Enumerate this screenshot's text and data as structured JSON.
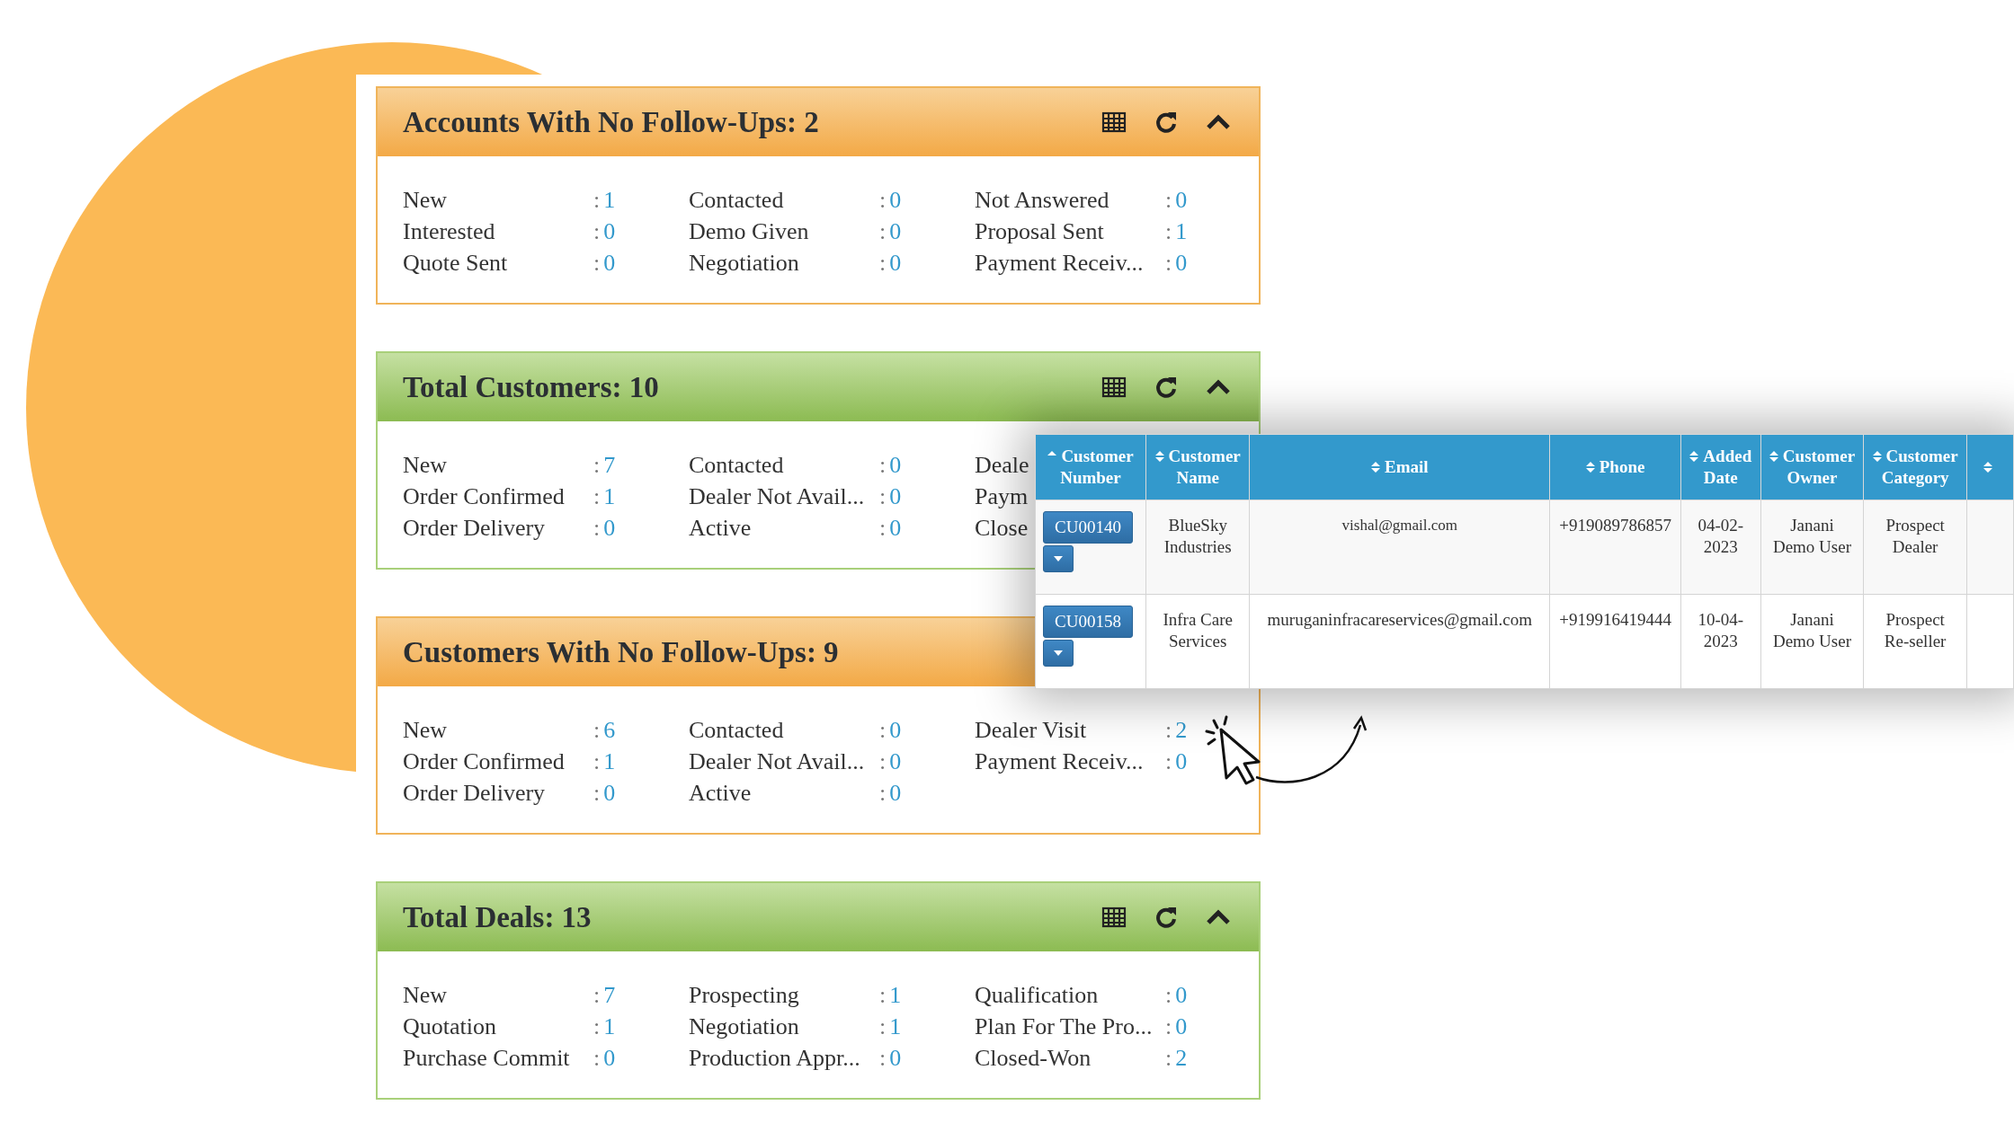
{
  "cards": [
    {
      "title": "Accounts With No Follow-Ups: 2",
      "kind": "orange",
      "columns": [
        [
          {
            "label": "New",
            "sep": ":",
            "value": "1"
          },
          {
            "label": "Interested",
            "sep": ":",
            "value": "0"
          },
          {
            "label": "Quote Sent",
            "sep": ":",
            "value": "0"
          }
        ],
        [
          {
            "label": "Contacted",
            "sep": ":",
            "value": "0"
          },
          {
            "label": "Demo Given",
            "sep": ":",
            "value": "0"
          },
          {
            "label": "Negotiation",
            "sep": ":",
            "value": "0"
          }
        ],
        [
          {
            "label": "Not Answered",
            "sep": ":",
            "value": "0"
          },
          {
            "label": "Proposal Sent",
            "sep": ":",
            "value": "1"
          },
          {
            "label": "Payment Receiv...",
            "sep": ":",
            "value": "0"
          }
        ]
      ]
    },
    {
      "title": "Total Customers: 10",
      "kind": "green",
      "columns": [
        [
          {
            "label": "New",
            "sep": ":",
            "value": "7"
          },
          {
            "label": "Order Confirmed",
            "sep": ":",
            "value": "1"
          },
          {
            "label": "Order Delivery",
            "sep": ":",
            "value": "0"
          }
        ],
        [
          {
            "label": "Contacted",
            "sep": ":",
            "value": "0"
          },
          {
            "label": "Dealer Not Avail...",
            "sep": ":",
            "value": "0"
          },
          {
            "label": "Active",
            "sep": ":",
            "value": "0"
          }
        ],
        [
          {
            "label": "Deale"
          },
          {
            "label": "Paym"
          },
          {
            "label": "Close"
          }
        ]
      ]
    },
    {
      "title": "Customers With No Follow-Ups: 9",
      "kind": "orange",
      "columns": [
        [
          {
            "label": "New",
            "sep": ":",
            "value": "6"
          },
          {
            "label": "Order Confirmed",
            "sep": ":",
            "value": "1"
          },
          {
            "label": "Order Delivery",
            "sep": ":",
            "value": "0"
          }
        ],
        [
          {
            "label": "Contacted",
            "sep": ":",
            "value": "0"
          },
          {
            "label": "Dealer Not Avail...",
            "sep": ":",
            "value": "0"
          },
          {
            "label": "Active",
            "sep": ":",
            "value": "0"
          }
        ],
        [
          {
            "label": "Dealer Visit",
            "sep": ":",
            "value": "2"
          },
          {
            "label": "Payment Receiv...",
            "sep": ":",
            "value": "0"
          }
        ]
      ]
    },
    {
      "title": "Total Deals: 13",
      "kind": "green",
      "columns": [
        [
          {
            "label": "New",
            "sep": ":",
            "value": "7"
          },
          {
            "label": "Quotation",
            "sep": ":",
            "value": "1"
          },
          {
            "label": "Purchase Commit",
            "sep": ":",
            "value": "0"
          }
        ],
        [
          {
            "label": "Prospecting",
            "sep": ":",
            "value": "1"
          },
          {
            "label": "Negotiation",
            "sep": ":",
            "value": "1"
          },
          {
            "label": "Production Appr...",
            "sep": ":",
            "value": "0"
          }
        ],
        [
          {
            "label": "Qualification",
            "sep": ":",
            "value": "0"
          },
          {
            "label": "Plan For The Pro...",
            "sep": ":",
            "value": "0"
          },
          {
            "label": "Closed-Won",
            "sep": ":",
            "value": "2"
          }
        ]
      ]
    }
  ],
  "table": {
    "columns": [
      {
        "label": "Customer Number",
        "sorted": true
      },
      {
        "label": "Customer Name",
        "sorted": false
      },
      {
        "label": "Email",
        "sorted": false
      },
      {
        "label": "Phone",
        "sorted": false
      },
      {
        "label": "Added Date",
        "sorted": false
      },
      {
        "label": "Customer Owner",
        "sorted": false
      },
      {
        "label": "Customer Category",
        "sorted": false
      },
      {
        "sorted": false
      }
    ],
    "rows": [
      {
        "number": "CU00140",
        "name": "BlueSky Industries",
        "email": "vishal@gmail.com",
        "phone": "+919089786857",
        "added_date": "04-02-2023",
        "owner": "Janani Demo User",
        "category": "Prospect Dealer"
      },
      {
        "number": "CU00158",
        "name": "Infra Care Services",
        "email": "muruganinfracareservices@gmail.com",
        "phone": "+919916419444",
        "added_date": "10-04-2023",
        "owner": "Janani Demo User",
        "category": "Prospect Re-seller"
      }
    ]
  }
}
